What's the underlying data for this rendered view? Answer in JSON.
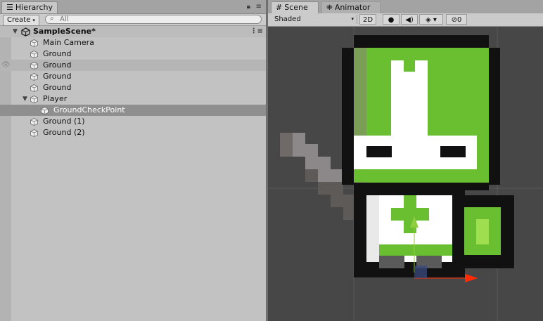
{
  "hierarchy": {
    "tab_label": "Hierarchy",
    "create_label": "Create",
    "search_placeholder": "All",
    "scene_name": "SampleScene*",
    "items": [
      {
        "label": "Main Camera"
      },
      {
        "label": "Ground"
      },
      {
        "label": "Ground"
      },
      {
        "label": "Ground"
      },
      {
        "label": "Ground"
      },
      {
        "label": "Player"
      },
      {
        "label": "GroundCheckPoint"
      },
      {
        "label": "Ground (1)"
      },
      {
        "label": "Ground (2)"
      }
    ]
  },
  "scene": {
    "tabs": [
      {
        "label": "Scene",
        "active": true
      },
      {
        "label": "Animator",
        "active": false
      }
    ],
    "shading_mode": "Shaded",
    "mode_2d": "2D",
    "hidden_count": "0"
  },
  "colors": {
    "knight_green": "#6abf30",
    "sword_grey": "#908a90",
    "gizmo_red": "#ff2a00",
    "shield_green": "#8fcf3f"
  }
}
